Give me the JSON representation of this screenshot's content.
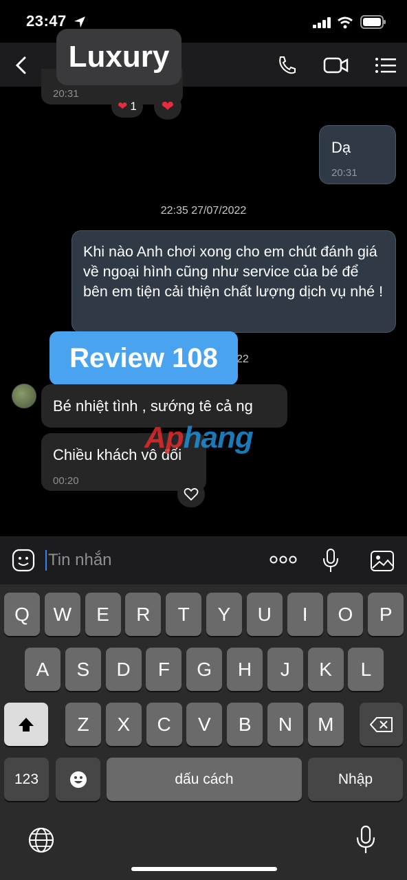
{
  "status": {
    "time": "23:47"
  },
  "header": {
    "title_overlay": "Luxury"
  },
  "messages": {
    "prev_time": "20:31",
    "prev_reaction_count": "1",
    "out1_text": "Dạ",
    "out1_time": "20:31",
    "date_separator_1": "22:35 27/07/2022",
    "out2_text": "Khi nào Anh chơi xong cho em chút đánh giá về ngoại hình cũng như service của bé để bên em tiện cải thiện chất lượng dịch vụ nhé !",
    "date_separator_2_tail": "22",
    "in1_text": "Bé nhiệt tình , sướng tê cả ng",
    "in2_text": "Chiều khách vô đối",
    "in2_time": "00:20"
  },
  "overlays": {
    "review_label": "Review 108",
    "watermark": "Aphang"
  },
  "composer": {
    "placeholder": "Tin nhắn"
  },
  "keyboard": {
    "row1": [
      "Q",
      "W",
      "E",
      "R",
      "T",
      "Y",
      "U",
      "I",
      "O",
      "P"
    ],
    "row2": [
      "A",
      "S",
      "D",
      "F",
      "G",
      "H",
      "J",
      "K",
      "L"
    ],
    "row3": [
      "Z",
      "X",
      "C",
      "V",
      "B",
      "N",
      "M"
    ],
    "numbers_key": "123",
    "space_key": "dấu cách",
    "return_key": "Nhập"
  },
  "colors": {
    "background": "#000000",
    "outgoing_bubble": "#2f3a46",
    "incoming_bubble": "#262626",
    "review_badge": "#4aa3ee"
  }
}
